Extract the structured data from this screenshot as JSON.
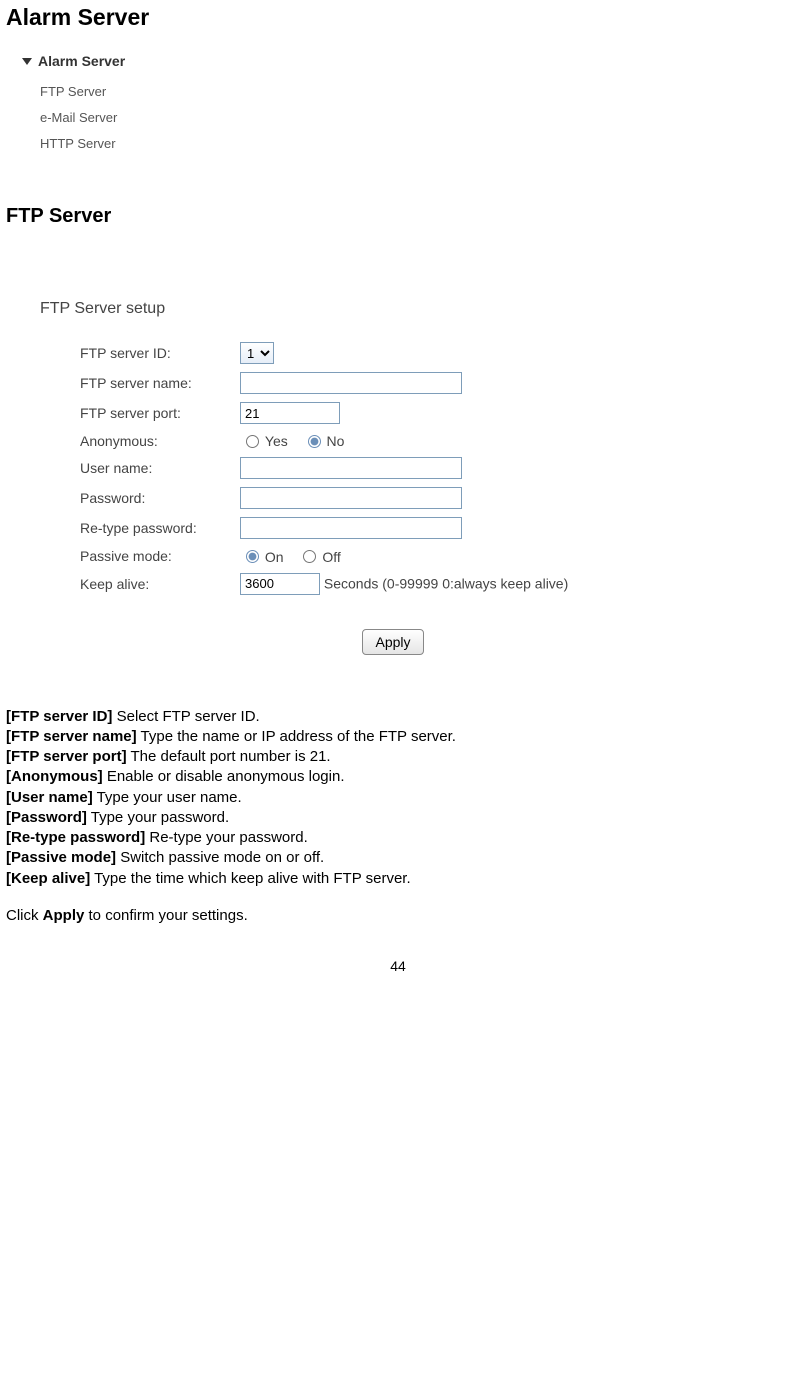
{
  "headings": {
    "main": "Alarm Server",
    "sub": "FTP Server"
  },
  "nav": {
    "root": "Alarm Server",
    "items": [
      "FTP Server",
      "e-Mail Server",
      "HTTP Server"
    ]
  },
  "form": {
    "title": "FTP Server setup",
    "labels": {
      "id": "FTP server ID:",
      "name": "FTP server name:",
      "port": "FTP server port:",
      "anon": "Anonymous:",
      "user": "User name:",
      "pass": "Password:",
      "repass": "Re-type password:",
      "passive": "Passive mode:",
      "keep": "Keep alive:"
    },
    "values": {
      "id": "1",
      "name": "",
      "port": "21",
      "anon": "No",
      "user": "",
      "pass": "",
      "repass": "",
      "passive": "On",
      "keepalive": "3600"
    },
    "radio": {
      "yes": "Yes",
      "no": "No",
      "on": "On",
      "off": "Off"
    },
    "keep_hint": "Seconds (0-99999 0:always keep alive)",
    "apply": "Apply"
  },
  "desc": [
    {
      "k": "[FTP server ID]",
      "v": " Select FTP server ID."
    },
    {
      "k": "[FTP server name]",
      "v": " Type the name or IP address of the FTP server."
    },
    {
      "k": "[FTP server port]",
      "v": " The default port number is 21."
    },
    {
      "k": "[Anonymous]",
      "v": " Enable or disable anonymous login."
    },
    {
      "k": "[User name]",
      "v": " Type your user name."
    },
    {
      "k": "[Password]",
      "v": " Type your password."
    },
    {
      "k": "[Re-type password]",
      "v": " Re-type your password."
    },
    {
      "k": "[Passive mode]",
      "v": " Switch passive mode on or off."
    },
    {
      "k": "[Keep alive]",
      "v": " Type the time which keep alive with FTP server."
    }
  ],
  "closing": {
    "pre": "Click ",
    "bold": "Apply",
    "post": " to confirm your settings."
  },
  "pagenum": "44"
}
